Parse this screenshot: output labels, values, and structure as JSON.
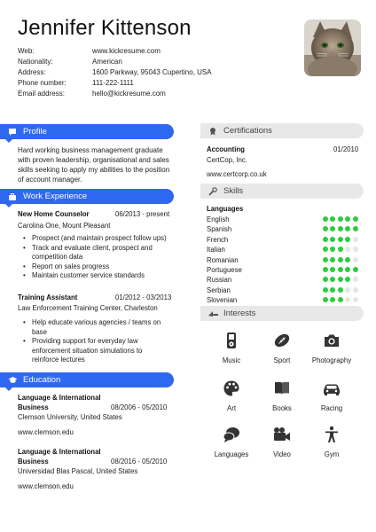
{
  "name": "Jennifer Kittenson",
  "contact": [
    {
      "label": "Web:",
      "value": "www.kickresume.com"
    },
    {
      "label": "Nationality:",
      "value": "American"
    },
    {
      "label": "Address:",
      "value": "1600 Parkway, 95043 Cupertino, USA"
    },
    {
      "label": "Phone number:",
      "value": "111-222-1111"
    },
    {
      "label": "Email address:",
      "value": "hello@kickresume.com"
    }
  ],
  "profile": {
    "title": "Profile",
    "text": "Hard working business management graduate with proven leadership, organisational and sales skills seeking to apply my abilities to the position of account manager."
  },
  "work": {
    "title": "Work Experience",
    "items": [
      {
        "title": "New Home Counselor",
        "date": "06/2013 - present",
        "sub": "Carolina One, Mount Pleasant",
        "bullets": [
          "Prospect (and maintain prospect follow ups)",
          "Track and evaluate client, prospect and competition data",
          "Report on sales progress",
          "Maintain customer service standards"
        ]
      },
      {
        "title": "Training Assistant",
        "date": "01/2012 - 03/2013",
        "sub": "Law Enforcement Training Center, Charleston",
        "bullets": [
          "Help educate various agencies / teams on base",
          "Providing support for everyday law enforcement situation simulations to reinforce lectures"
        ]
      }
    ]
  },
  "education": {
    "title": "Education",
    "items": [
      {
        "title1": "Language & International",
        "title2": "Business",
        "date": "08/2006 - 05/2010",
        "sub": "Clemson University, United States",
        "web": "www.clemson.edu"
      },
      {
        "title1": "Language & International",
        "title2": "Business",
        "date": "08/2016 - 05/2010",
        "sub": "Universidad Blas Pascal, United States",
        "web": "www.clemson.edu"
      }
    ]
  },
  "certifications": {
    "title": "Certifications",
    "name": "Accounting",
    "date": "01/2010",
    "issuer": "CertCop, Inc.",
    "web": "www.certcorp.co.uk"
  },
  "skills": {
    "title": "Skills",
    "subtitle": "Languages",
    "languages": [
      {
        "name": "English",
        "level": 5
      },
      {
        "name": "Spanish",
        "level": 5
      },
      {
        "name": "French",
        "level": 4
      },
      {
        "name": "Italian",
        "level": 3
      },
      {
        "name": "Romanian",
        "level": 4
      },
      {
        "name": "Portuguese",
        "level": 5
      },
      {
        "name": "Russian",
        "level": 4
      },
      {
        "name": "Serbian",
        "level": 3
      },
      {
        "name": "Slovenian",
        "level": 3
      }
    ],
    "max_level": 5,
    "on_color": "#2ecc40",
    "off_color": "#e6e6e6"
  },
  "interests": {
    "title": "Interests",
    "items": [
      {
        "label": "Music",
        "icon": "ipod-icon"
      },
      {
        "label": "Sport",
        "icon": "football-icon"
      },
      {
        "label": "Photography",
        "icon": "camera-icon"
      },
      {
        "label": "Art",
        "icon": "palette-icon"
      },
      {
        "label": "Books",
        "icon": "book-icon"
      },
      {
        "label": "Racing",
        "icon": "car-icon"
      },
      {
        "label": "Languages",
        "icon": "speech-bubbles-icon"
      },
      {
        "label": "Video",
        "icon": "video-camera-icon"
      },
      {
        "label": "Gym",
        "icon": "person-icon"
      }
    ]
  },
  "colors": {
    "accent": "#2f68f0",
    "grey_header": "#e8e8e8"
  }
}
